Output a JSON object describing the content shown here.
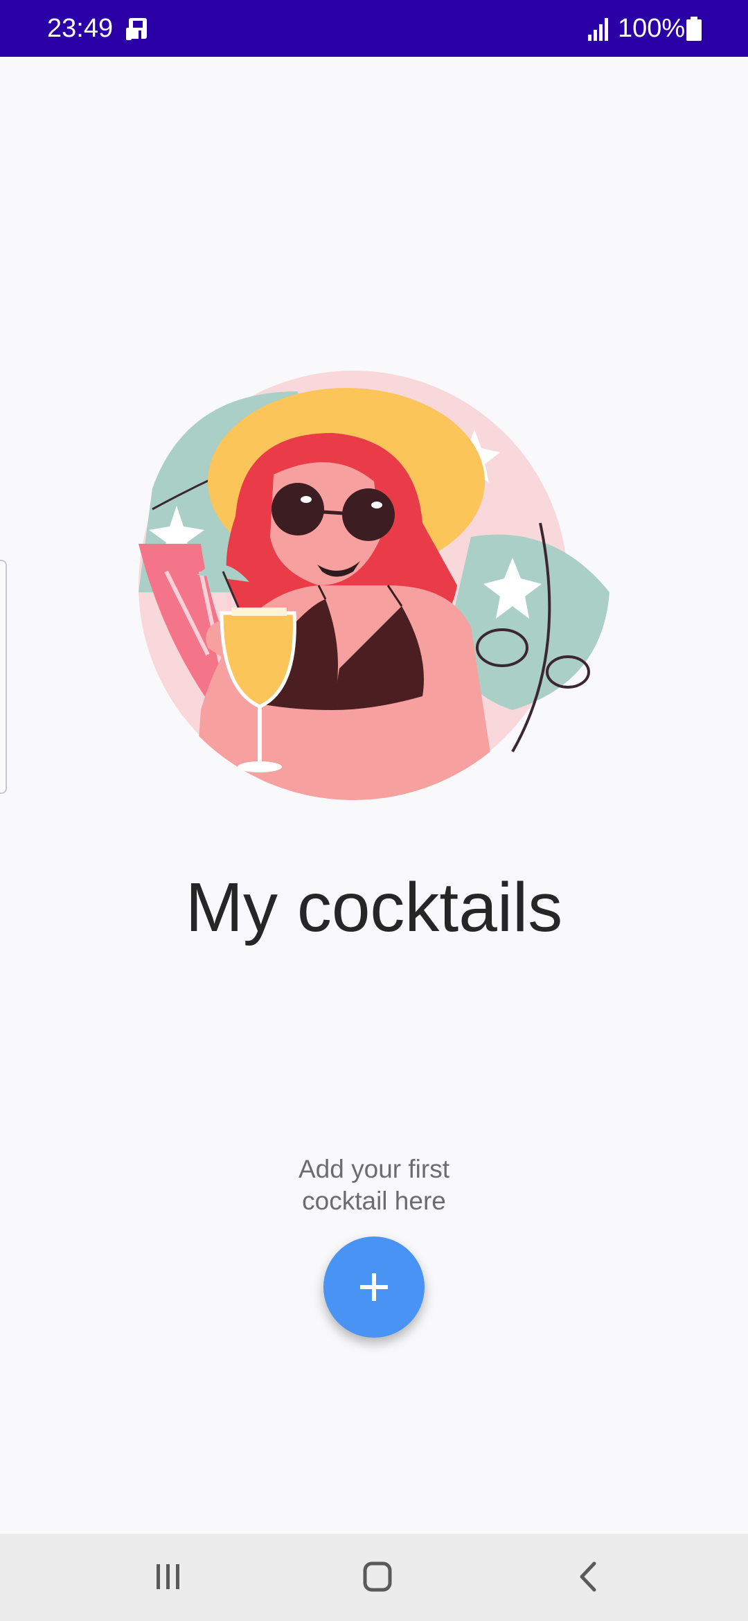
{
  "status_bar": {
    "time": "23:49",
    "battery": "100%",
    "icons": [
      "notification-icon",
      "signal-icon",
      "battery-icon"
    ],
    "background_color": "#2a00a6"
  },
  "main": {
    "illustration": "woman-with-cocktail-illustration",
    "title": "My cocktails",
    "empty_hint": "Add your first cocktail here",
    "add_button_icon": "plus-icon",
    "accent_color": "#4893f3"
  },
  "nav_bar": {
    "buttons": [
      "recent-apps-icon",
      "home-icon",
      "back-icon"
    ]
  }
}
